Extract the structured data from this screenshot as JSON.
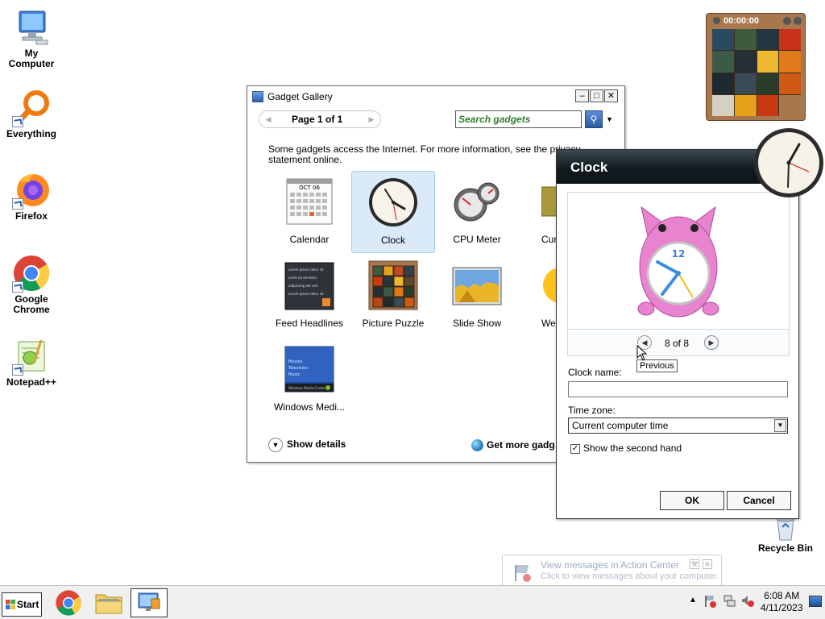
{
  "desktop": {
    "icons": [
      {
        "label": "My Computer"
      },
      {
        "label": "Everything"
      },
      {
        "label": "Firefox"
      },
      {
        "label_line1": "Google",
        "label_line2": "Chrome"
      },
      {
        "label": "Notepad++"
      },
      {
        "label": "Recycle Bin"
      }
    ]
  },
  "gallery": {
    "title": "Gadget Gallery",
    "page_text": "Page 1 of 1",
    "search_placeholder": "Search gadgets",
    "notice_line1": "Some gadgets access the Internet.  For more information, see the privacy",
    "notice_line2": "statement online.",
    "gadgets": [
      {
        "label": "Calendar"
      },
      {
        "label": "Clock"
      },
      {
        "label": "CPU Meter"
      },
      {
        "label": "Cur"
      },
      {
        "label": "Feed Headlines"
      },
      {
        "label": "Picture Puzzle"
      },
      {
        "label": "Slide Show"
      },
      {
        "label": "We"
      },
      {
        "label": "Windows Medi..."
      }
    ],
    "show_details": "Show details",
    "get_more": "Get more gadg",
    "calendar_month": "OCT 06",
    "feed_preview_lines": [
      "Lorem Ipsum dolor sit",
      "amet consectetur",
      "adipiscing elit sed"
    ],
    "media_center_lines": [
      "Movies",
      "Television",
      "Music"
    ],
    "media_center_caption": "Windows Media Center"
  },
  "clock_dialog": {
    "title": "Clock",
    "counter": "8 of 8",
    "tooltip": "Previous",
    "clock_name_label": "Clock name:",
    "clock_name_value": "",
    "time_zone_label": "Time zone:",
    "time_zone_value": "Current computer time",
    "second_hand_label": "Show the second hand",
    "second_hand_checked": "✓",
    "ok": "OK",
    "cancel": "Cancel",
    "preview_numeral": "12"
  },
  "puzzle_gadget": {
    "timer": "00:00:00"
  },
  "taskbar": {
    "start": "Start",
    "time": "6:08 AM",
    "date": "4/11/2023"
  },
  "balloon": {
    "title": "View messages in Action Center",
    "subtitle": "Click to view messages about your computer."
  }
}
